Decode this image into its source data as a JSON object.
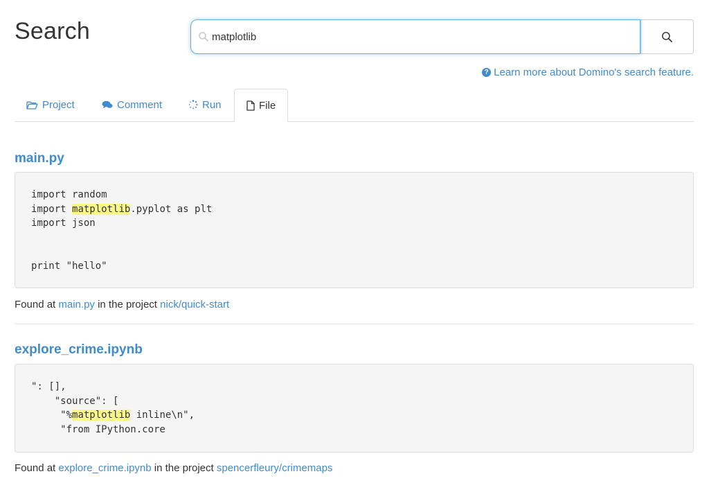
{
  "page": {
    "title": "Search"
  },
  "search": {
    "value": "matplotlib",
    "placeholder": "",
    "button_label": ""
  },
  "help": {
    "text": "Learn more about Domino's search feature."
  },
  "tabs": [
    {
      "label": "Project",
      "icon": "folder-open-icon",
      "active": false
    },
    {
      "label": "Comment",
      "icon": "comments-icon",
      "active": false
    },
    {
      "label": "Run",
      "icon": "spinner-icon",
      "active": false
    },
    {
      "label": "File",
      "icon": "file-icon",
      "active": true
    }
  ],
  "results": [
    {
      "title": "main.py",
      "code_lines": [
        {
          "pre": "import random",
          "hl": "",
          "post": ""
        },
        {
          "pre": "import ",
          "hl": "matplotlib",
          "post": ".pyplot as plt"
        },
        {
          "pre": "import json",
          "hl": "",
          "post": ""
        },
        {
          "pre": "",
          "hl": "",
          "post": ""
        },
        {
          "pre": "",
          "hl": "",
          "post": ""
        },
        {
          "pre": "print \"hello\"",
          "hl": "",
          "post": ""
        }
      ],
      "found_prefix": "Found at",
      "file_link": "main.py",
      "in_project_text": "in the project",
      "project_link": "nick/quick-start"
    },
    {
      "title": "explore_crime.ipynb",
      "code_lines": [
        {
          "pre": "\": [],",
          "hl": "",
          "post": ""
        },
        {
          "pre": "    \"source\": [",
          "hl": "",
          "post": ""
        },
        {
          "pre": "     \"%",
          "hl": "matplotlib",
          "post": " inline\\n\","
        },
        {
          "pre": "     \"from IPython.core",
          "hl": "",
          "post": ""
        }
      ],
      "found_prefix": "Found at",
      "file_link": "explore_crime.ipynb",
      "in_project_text": "in the project",
      "project_link": "spencerfleury/crimemaps"
    }
  ],
  "colors": {
    "link": "#428bca",
    "highlight": "#fcf88a",
    "code_bg": "#f5f5f5",
    "focus": "#66afe9"
  }
}
